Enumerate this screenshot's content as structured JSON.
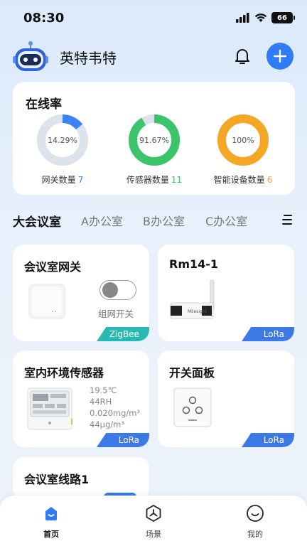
{
  "status": {
    "time": "08:30",
    "battery": "66"
  },
  "header": {
    "home_name": "英特韦特"
  },
  "online": {
    "title": "在线率",
    "rings": [
      {
        "percent_text": "14.29%",
        "value": 0.1429,
        "label": "网关数量",
        "count": "7",
        "color": "#3b82f6",
        "count_color": "#3b82f6"
      },
      {
        "percent_text": "91.67%",
        "value": 0.9167,
        "label": "传感器数量",
        "count": "11",
        "color": "#3cc46a",
        "count_color": "#3cc46a"
      },
      {
        "percent_text": "100%",
        "value": 1.0,
        "label": "智能设备数量",
        "count": "6",
        "color": "#f5a623",
        "count_color": "#f5a623"
      }
    ],
    "track_color": "#dde3ea"
  },
  "tabs": [
    "大会议室",
    "A办公室",
    "B办公室",
    "C办公室"
  ],
  "devices": {
    "gateway": {
      "title": "会议室网关",
      "toggle_label": "组网开关",
      "protocol": "ZigBee"
    },
    "rm14": {
      "title": "Rm14-1",
      "protocol": "LoRa"
    },
    "env_sensor": {
      "title": "室内环境传感器",
      "readings": [
        "19.5℃",
        "44RH",
        "0.020mg/m³",
        "44μg/m³"
      ],
      "protocol": "LoRa"
    },
    "switch_panel": {
      "title": "开关面板",
      "protocol": "LoRa"
    },
    "circuit": {
      "title": "会议室线路1"
    }
  },
  "nav": {
    "home": "首页",
    "scene": "场景",
    "mine": "我的"
  },
  "colors": {
    "accent": "#2f7cf6",
    "lora": "#3b7ae6",
    "zigbee": "#27b9b4"
  }
}
